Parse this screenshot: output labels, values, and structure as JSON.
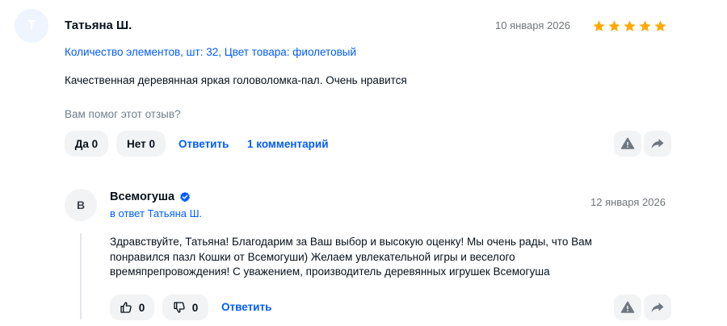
{
  "review": {
    "avatar_letter": "T",
    "author": "Татьяна Ш.",
    "date": "10 января 2026",
    "rating": 5,
    "properties": "Количество элементов, шт: 32, Цвет товара: фиолетовый",
    "text": "Качественная деревянная яркая головоломка-пал. Очень нравится",
    "helpful_question": "Вам помог этот отзыв?",
    "yes_label": "Да 0",
    "no_label": "Нет 0",
    "reply_label": "Ответить",
    "comments_label": "1 комментарий"
  },
  "seller_reply": {
    "avatar_letter": "B",
    "author": "Всемогуша",
    "in_reply_to": "в ответ Татьяна Ш.",
    "date": "12 января 2026",
    "text": "Здравствуйте, Татьяна! Благодарим за Ваш выбор и высокую оценку! Мы очень рады, что Вам понравился пазл Кошки от Всемогуши) Желаем увлекательной игры и веселого времяпрепровождения! С уважением, производитель деревянных игрушек Всемогуша",
    "likes": "0",
    "dislikes": "0",
    "reply_label": "Ответить"
  },
  "colors": {
    "accent": "#005bff",
    "star": "#ffa800",
    "verified": "#005bff"
  }
}
